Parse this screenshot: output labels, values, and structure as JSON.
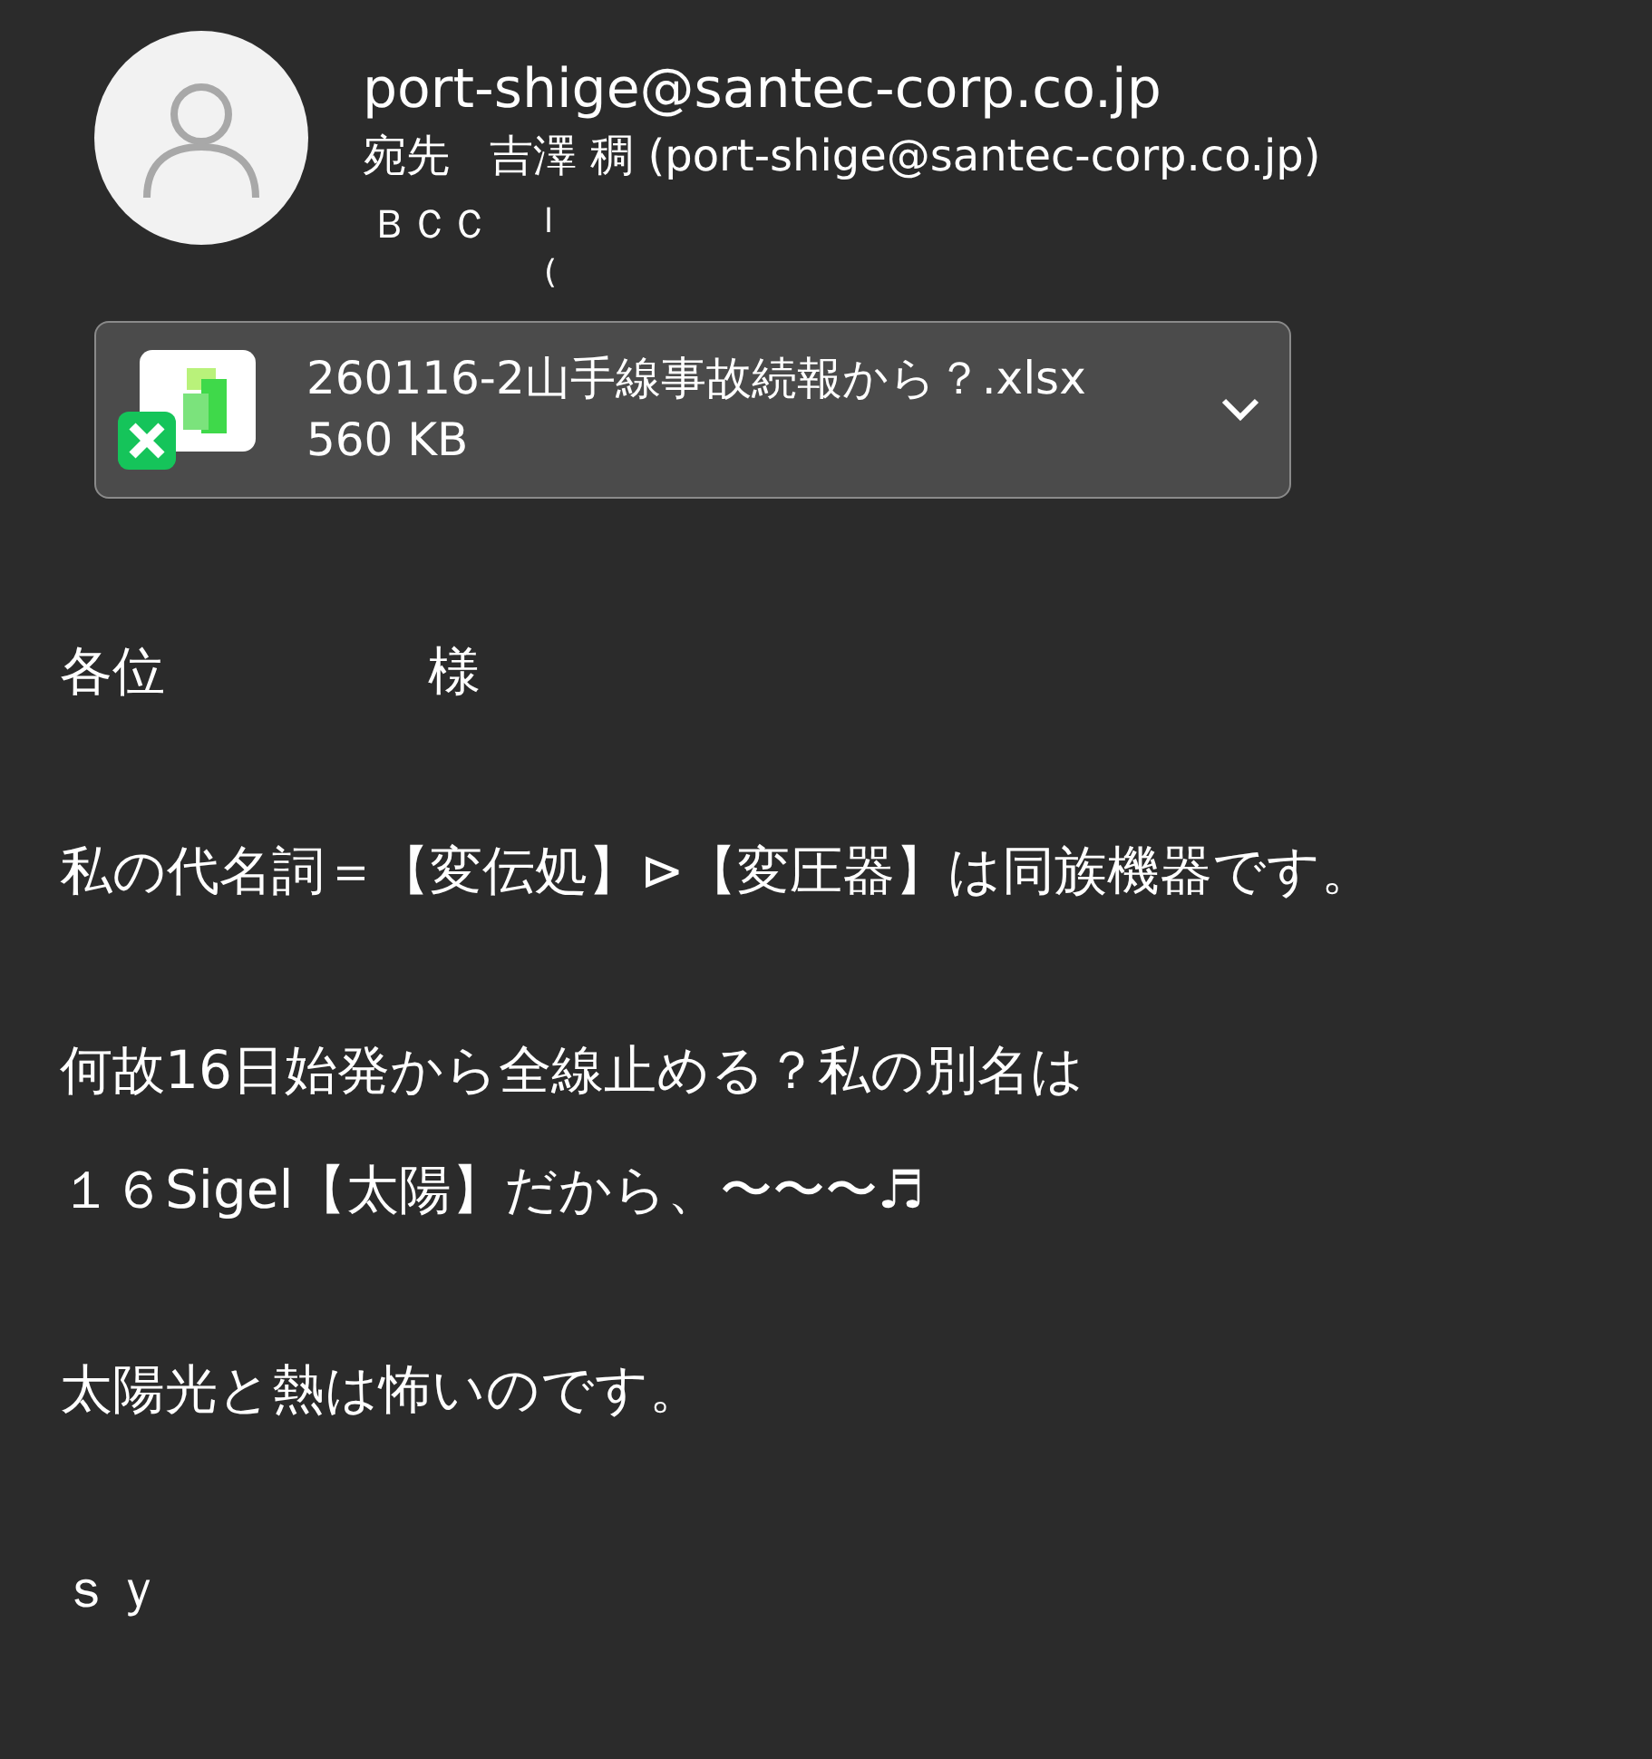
{
  "sender": {
    "address": "port-shige@santec-corp.co.jp",
    "to_label": "宛先",
    "to_value": "吉澤 稠 (port-shige@santec-corp.co.jp)",
    "bcc_label": "ＢＣＣ",
    "bcc_values": [
      "l",
      "("
    ]
  },
  "attachment": {
    "file_name": "260116-2山手線事故続報から？.xlsx",
    "size": "560 KB"
  },
  "body": [
    [
      "各位　　　　　様"
    ],
    [
      "私の代名詞＝【変伝処】⊳【変圧器】は同族機器です。"
    ],
    [
      "何故16日始発から全線止める？私の別名は",
      "１６Sigel【太陽】だから、〜〜〜♬"
    ],
    [
      "太陽光と熱は怖いのです。"
    ],
    [
      "ｓｙ"
    ]
  ]
}
